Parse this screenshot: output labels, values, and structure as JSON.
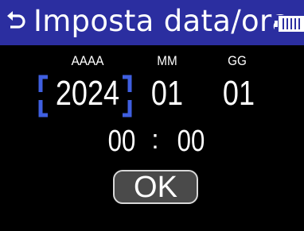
{
  "header": {
    "title": "Imposta data/ora",
    "back_icon": "back-arrow-icon",
    "battery_icon": "battery-icon",
    "background_color": "#2b2ea0"
  },
  "date_fields": {
    "year": {
      "label": "AAAA",
      "value": "2024",
      "selected": true
    },
    "month": {
      "label": "MM",
      "value": "01",
      "selected": false
    },
    "day": {
      "label": "GG",
      "value": "01",
      "selected": false
    }
  },
  "time_fields": {
    "hour": "00",
    "separator": ":",
    "minute": "00"
  },
  "ok_button": {
    "label": "OK"
  },
  "colors": {
    "selection_bracket": "#3f5fe0",
    "background": "#000000"
  }
}
